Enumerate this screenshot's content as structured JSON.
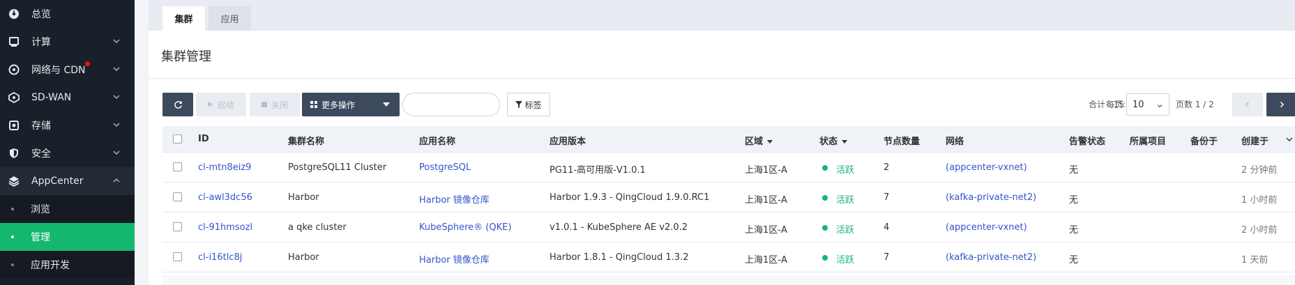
{
  "sidebar": {
    "items": [
      {
        "label": "总览",
        "icon": "dashboard-icon",
        "chevron": false
      },
      {
        "label": "计算",
        "icon": "monitor-icon",
        "chevron": true
      },
      {
        "label": "网络与 CDN",
        "icon": "network-icon",
        "chevron": true,
        "badge": true
      },
      {
        "label": "SD-WAN",
        "icon": "sdwan-icon",
        "chevron": true
      },
      {
        "label": "存储",
        "icon": "storage-icon",
        "chevron": true
      },
      {
        "label": "安全",
        "icon": "shield-icon",
        "chevron": true
      },
      {
        "label": "AppCenter",
        "icon": "layers-icon",
        "chevron": true,
        "open": true
      }
    ],
    "sub_items": [
      {
        "label": "浏览",
        "active": false
      },
      {
        "label": "管理",
        "active": true
      },
      {
        "label": "应用开发",
        "active": false
      }
    ]
  },
  "tabs": [
    {
      "label": "集群",
      "active": true
    },
    {
      "label": "应用",
      "active": false
    }
  ],
  "page_title": "集群管理",
  "toolbar": {
    "refresh_icon": "refresh-icon",
    "start_label": "启动",
    "stop_label": "关闭",
    "more_label": "更多操作",
    "search_placeholder": "",
    "tag_label": "标签"
  },
  "pager": {
    "total_label": "合计 : 15",
    "per_page_label": "每页:",
    "per_page_value": "10",
    "page_label": "页数 1 / 2"
  },
  "table": {
    "columns": [
      "ID",
      "集群名称",
      "应用名称",
      "应用版本",
      "区域",
      "状态",
      "节点数量",
      "网络",
      "告警状态",
      "所属项目",
      "备份于",
      "创建于"
    ],
    "rows": [
      {
        "id": "cl-mtn8eiz9",
        "name": "PostgreSQL11 Cluster",
        "app": "PostgreSQL",
        "version": "PG11-高可用版-V1.0.1",
        "zone": "上海1区-A",
        "status": "活跃",
        "nodes": "2",
        "network": "(appcenter-vxnet)",
        "alert": "无",
        "project": "",
        "backup": "",
        "created": "2 分钟前"
      },
      {
        "id": "cl-awl3dc56",
        "name": "Harbor",
        "app": "Harbor 镜像仓库",
        "version": "Harbor 1.9.3 - QingCloud 1.9.0.RC1",
        "zone": "上海1区-A",
        "status": "活跃",
        "nodes": "7",
        "network": "(kafka-private-net2)",
        "alert": "无",
        "project": "",
        "backup": "",
        "created": "1 小时前"
      },
      {
        "id": "cl-91hmsozl",
        "name": "a qke cluster",
        "app": "KubeSphere® (QKE)",
        "version": "v1.0.1 - KubeSphere AE v2.0.2",
        "zone": "上海1区-A",
        "status": "活跃",
        "nodes": "4",
        "network": "(appcenter-vxnet)",
        "alert": "无",
        "project": "",
        "backup": "",
        "created": "2 小时前"
      },
      {
        "id": "cl-i16tlc8j",
        "name": "Harbor",
        "app": "Harbor 镜像仓库",
        "version": "Harbor 1.8.1 - QingCloud 1.3.2",
        "zone": "上海1区-A",
        "status": "活跃",
        "nodes": "7",
        "network": "(kafka-private-net2)",
        "alert": "无",
        "project": "",
        "backup": "",
        "created": "1 天前"
      }
    ]
  },
  "colors": {
    "sidebar_bg": "#1a2029",
    "active_green": "#13b76f",
    "button_dark": "#3d4a5e",
    "link_blue": "#3355cc"
  }
}
